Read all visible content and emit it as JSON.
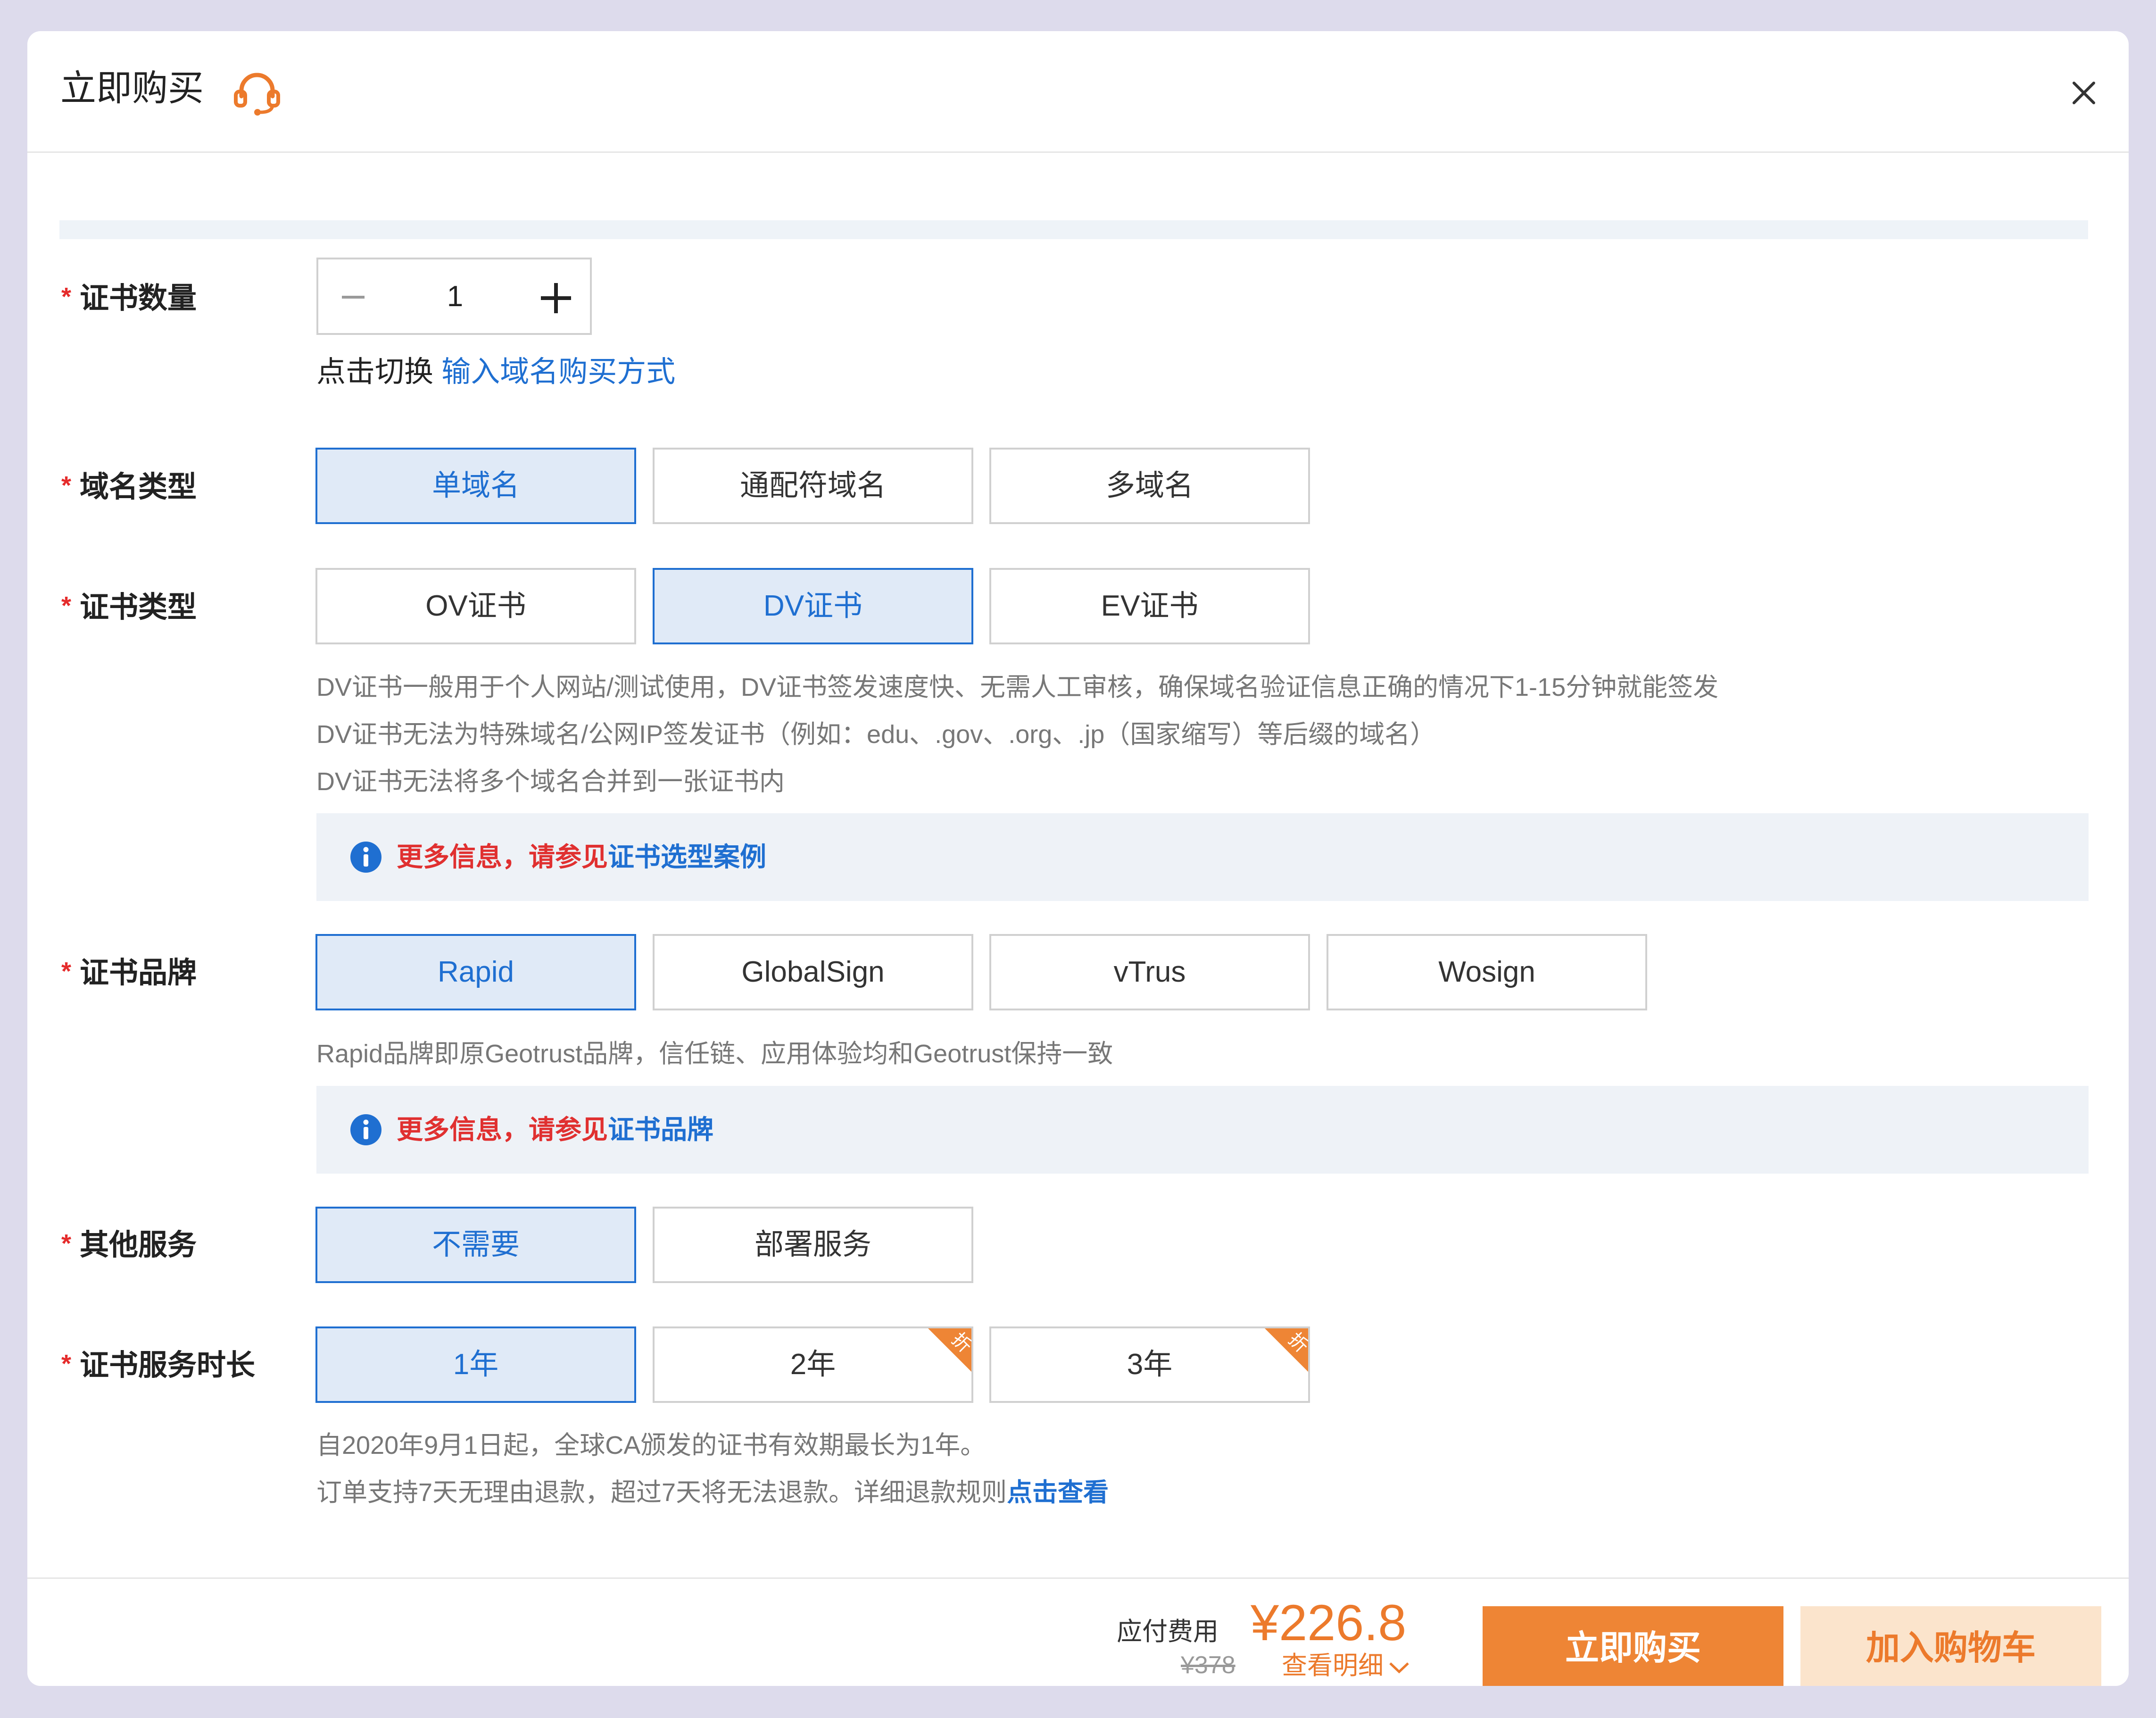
{
  "header": {
    "title": "立即购买",
    "support_icon": "headset-icon",
    "close_icon": "close-icon"
  },
  "colors": {
    "accent_blue": "#1f6fd1",
    "accent_orange": "#ec7a2c",
    "required_red": "#e52b2b",
    "selected_bg": "#e0eaf7"
  },
  "quantity": {
    "label": "证书数量",
    "required_mark": "*",
    "value": "1",
    "switch_text": "点击切换",
    "switch_link": "输入域名购买方式"
  },
  "domain_type": {
    "label": "域名类型",
    "required_mark": "*",
    "options": [
      "单域名",
      "通配符域名",
      "多域名"
    ],
    "selected": "单域名"
  },
  "cert_type": {
    "label": "证书类型",
    "required_mark": "*",
    "options": [
      "OV证书",
      "DV证书",
      "EV证书"
    ],
    "selected": "DV证书",
    "descriptions": [
      "DV证书一般用于个人网站/测试使用，DV证书签发速度快、无需人工审核，确保域名验证信息正确的情况下1-15分钟就能签发",
      "DV证书无法为特殊域名/公网IP签发证书（例如：edu、.gov、.org、.jp（国家缩写）等后缀的域名）",
      "DV证书无法将多个域名合并到一张证书内"
    ],
    "note_text": "更多信息，请参见",
    "note_link": "证书选型案例"
  },
  "brand": {
    "label": "证书品牌",
    "required_mark": "*",
    "options": [
      "Rapid",
      "GlobalSign",
      "vTrus",
      "Wosign"
    ],
    "selected": "Rapid",
    "description": "Rapid品牌即原Geotrust品牌，信任链、应用体验均和Geotrust保持一致",
    "note_text": "更多信息，请参见",
    "note_link": "证书品牌"
  },
  "other_service": {
    "label": "其他服务",
    "required_mark": "*",
    "options": [
      "不需要",
      "部署服务"
    ],
    "selected": "不需要"
  },
  "duration": {
    "label": "证书服务时长",
    "required_mark": "*",
    "options": [
      "1年",
      "2年",
      "3年"
    ],
    "selected": "1年",
    "discount_badge": "折",
    "description_1": "自2020年9月1日起，全球CA颁发的证书有效期最长为1年。",
    "description_2": "订单支持7天无理由退款，超过7天将无法退款。详细退款规则",
    "description_link": "点击查看"
  },
  "footer": {
    "fee_label": "应付费用",
    "price": "¥226.8",
    "original_price": "¥378",
    "detail_link": "查看明细",
    "buy_label": "立即购买",
    "cart_label": "加入购物车"
  }
}
